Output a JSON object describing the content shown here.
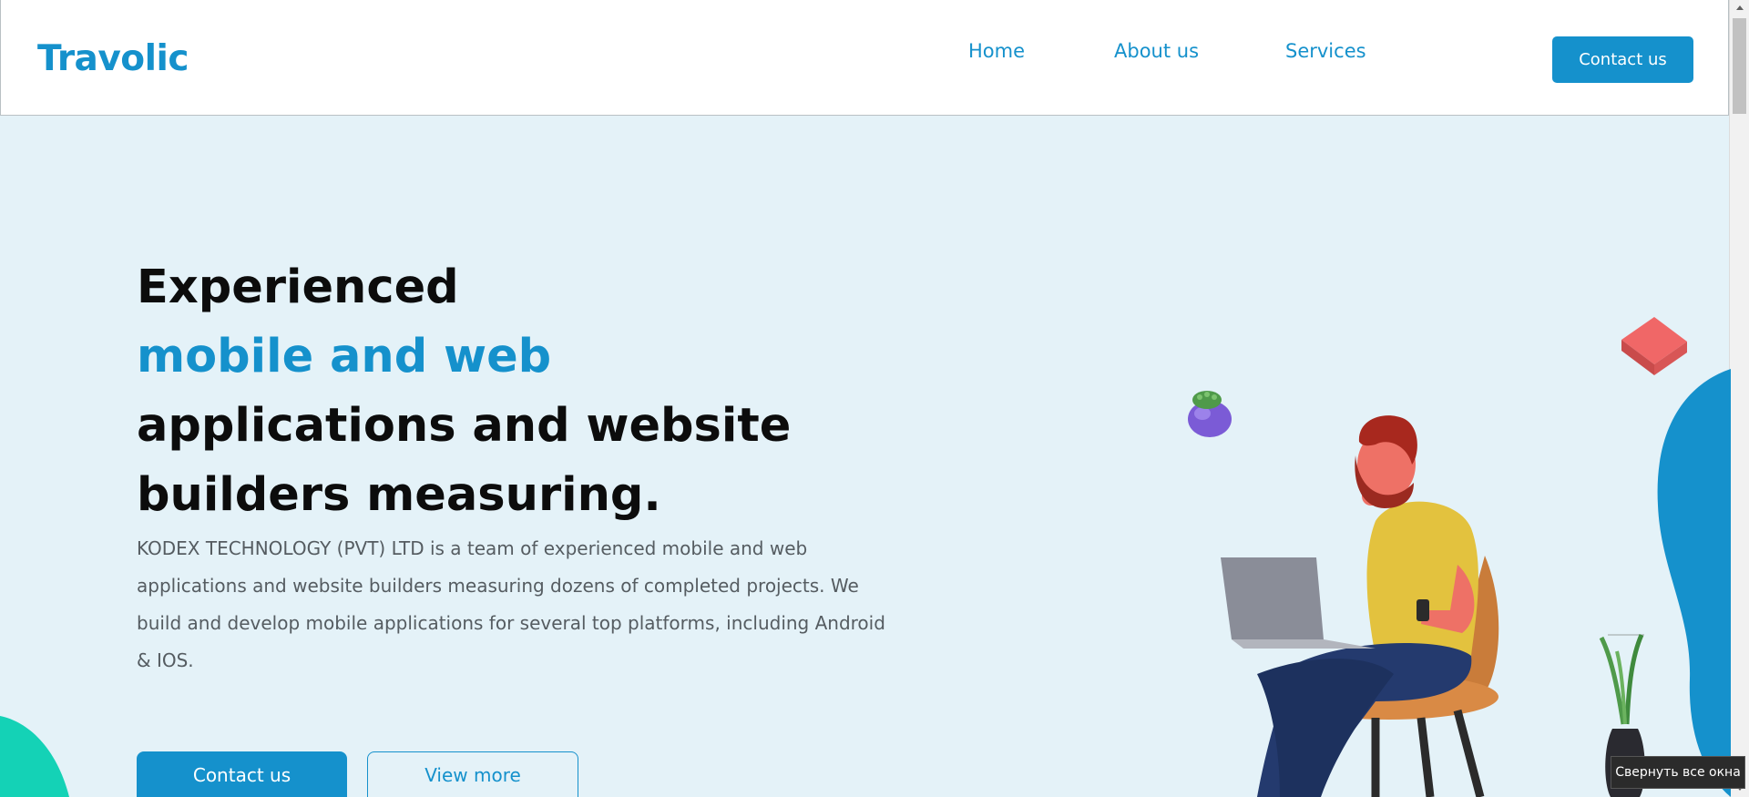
{
  "header": {
    "logo": "Travolic",
    "nav": [
      {
        "label": "Home"
      },
      {
        "label": "About us"
      },
      {
        "label": "Services"
      }
    ],
    "cta_label": "Contact us"
  },
  "hero": {
    "title_line1": "Experienced",
    "title_accent": "mobile and web",
    "title_line3": "applications and website",
    "title_line4": "builders measuring.",
    "description": "KODEX TECHNOLOGY (PVT) LTD is a team of experienced mobile and web applications and website builders measuring dozens of completed projects. We build and develop mobile applications for several top platforms, including Android & IOS.",
    "primary_button": "Contact us",
    "secondary_button": "View more"
  },
  "tooltip": {
    "text": "Свернуть все окна"
  },
  "colors": {
    "brand": "#1591cc",
    "hero_background": "#e4f2f8",
    "accent_teal": "#14d2b6"
  }
}
